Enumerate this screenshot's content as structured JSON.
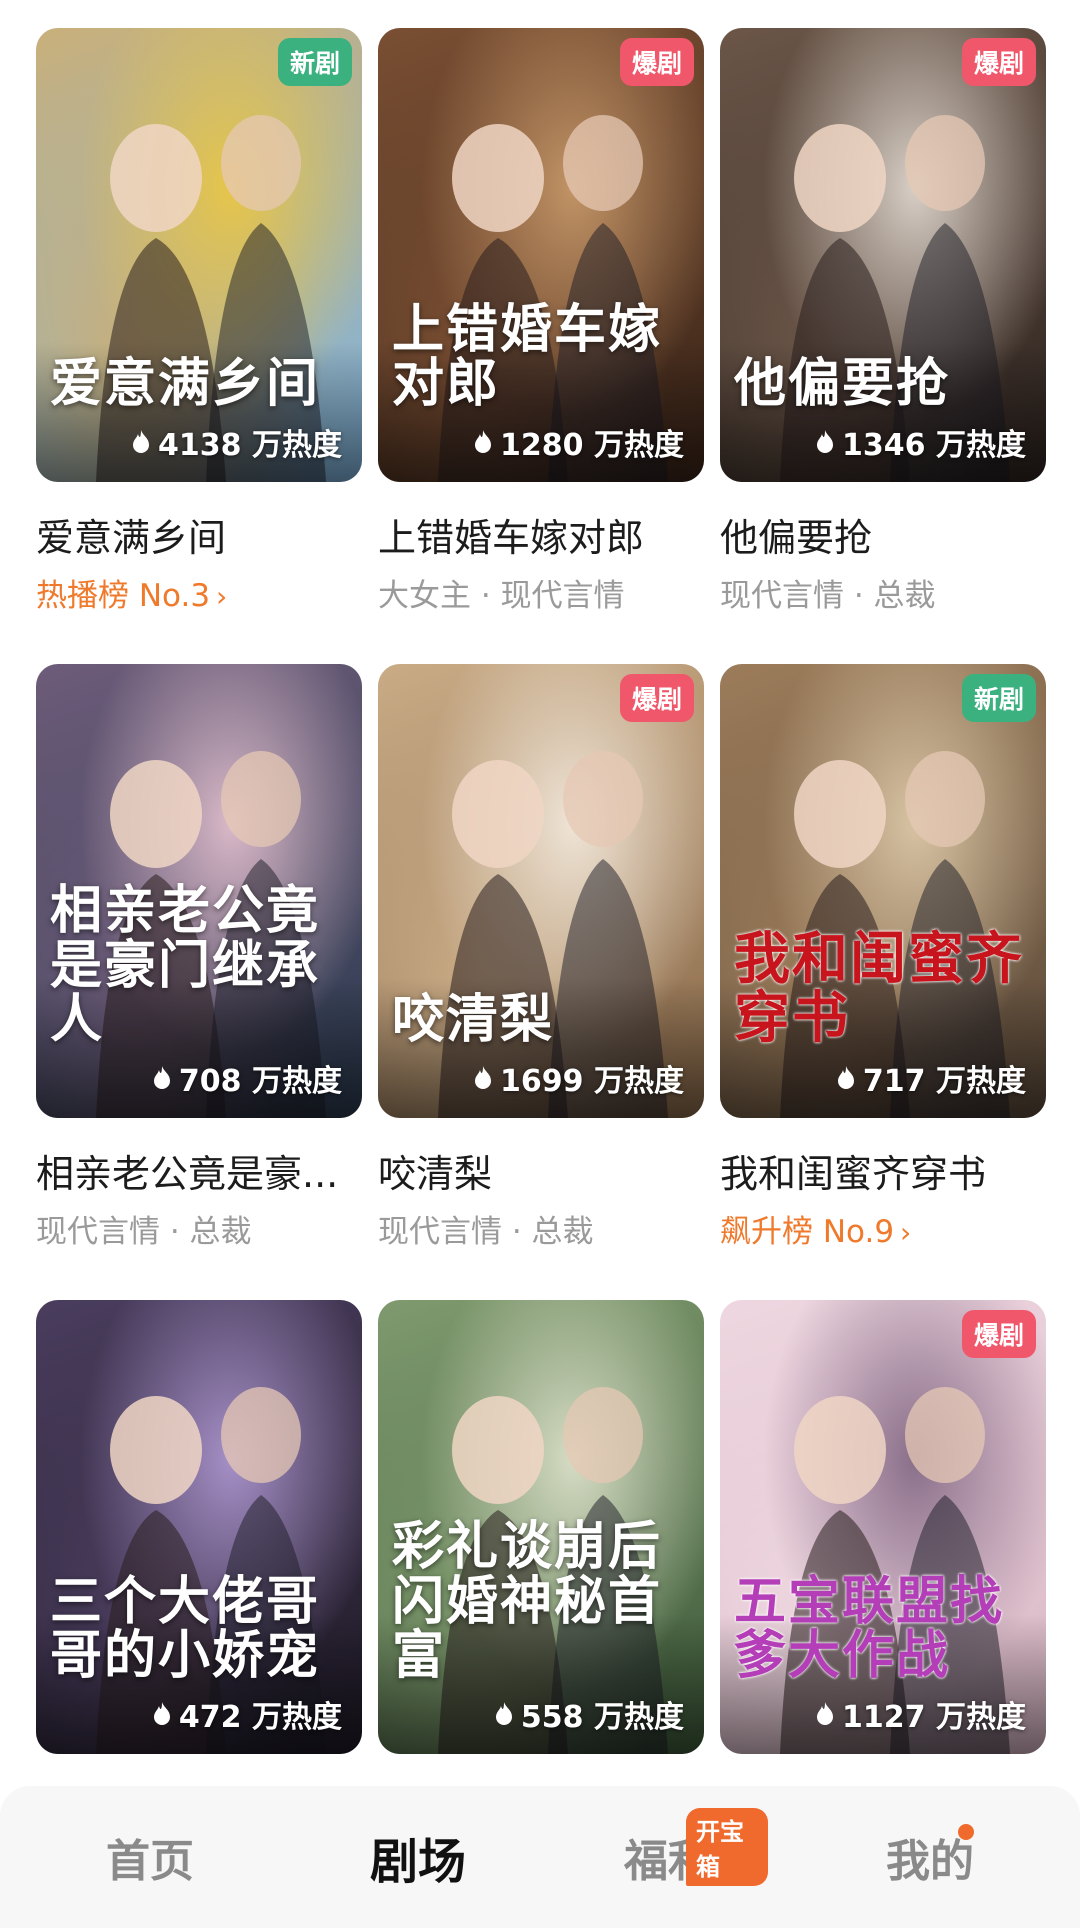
{
  "dramas": [
    {
      "badge": "新剧",
      "badge_type": "new",
      "title_art": "爱意满乡间",
      "heat": "4138 万热度",
      "name": "爱意满乡间",
      "sub": "热播榜 No.3",
      "sub_type": "rank",
      "palette": [
        "#7fb4de",
        "#c9b07a",
        "#e6c54a"
      ]
    },
    {
      "badge": "爆剧",
      "badge_type": "hot",
      "title_art": "上错婚车嫁对郎",
      "heat": "1280 万热度",
      "name": "上错婚车嫁对郎",
      "sub": "大女主 · 现代言情",
      "sub_type": "tags",
      "palette": [
        "#3a2418",
        "#7a4f33",
        "#c29466"
      ]
    },
    {
      "badge": "爆剧",
      "badge_type": "hot",
      "title_art": "他偏要抢",
      "heat": "1346 万热度",
      "name": "他偏要抢",
      "sub": "现代言情 · 总裁",
      "sub_type": "tags",
      "palette": [
        "#2e2420",
        "#6b5648",
        "#d8cfc6"
      ]
    },
    {
      "badge": "",
      "badge_type": "",
      "title_art": "相亲老公竟是豪门继承人",
      "heat": "708 万热度",
      "name": "相亲老公竟是豪...",
      "sub": "现代言情 · 总裁",
      "sub_type": "tags",
      "palette": [
        "#2b3a4f",
        "#6d5c7a",
        "#d9b9c8"
      ]
    },
    {
      "badge": "爆剧",
      "badge_type": "hot",
      "title_art": "咬清梨",
      "heat": "1699 万热度",
      "name": "咬清梨",
      "sub": "现代言情 · 总裁",
      "sub_type": "tags",
      "palette": [
        "#8a6a4a",
        "#c9ab86",
        "#efe4d6"
      ]
    },
    {
      "badge": "新剧",
      "badge_type": "new",
      "title_art": "我和闺蜜齐穿书",
      "heat": "717 万热度",
      "name": "我和闺蜜齐穿书",
      "sub": "飙升榜 No.9",
      "sub_type": "rank",
      "palette": [
        "#5b4a3a",
        "#9c7c5a",
        "#d7c3a3"
      ]
    },
    {
      "badge": "",
      "badge_type": "",
      "title_art": "三个大佬哥哥的小娇宠",
      "heat": "472 万热度",
      "name": "",
      "sub": "",
      "sub_type": "tags",
      "palette": [
        "#1f1a26",
        "#4a3d5e",
        "#a690c7"
      ]
    },
    {
      "badge": "",
      "badge_type": "",
      "title_art": "彩礼谈崩后闪婚神秘首富",
      "heat": "558 万热度",
      "name": "",
      "sub": "",
      "sub_type": "tags",
      "palette": [
        "#3e5a3a",
        "#7f9a6e",
        "#d6dcc4"
      ]
    },
    {
      "badge": "爆剧",
      "badge_type": "hot",
      "title_art": "五宝联盟找爹大作战",
      "heat": "1127 万热度",
      "name": "",
      "sub": "",
      "sub_type": "tags",
      "palette": [
        "#d9b7c5",
        "#eed7e0",
        "#8a6f8a"
      ]
    }
  ],
  "tabbar": {
    "tabs": [
      {
        "label": "首页",
        "active": false
      },
      {
        "label": "剧场",
        "active": true
      },
      {
        "label": "福利",
        "active": false,
        "badge": "开宝箱"
      },
      {
        "label": "我的",
        "active": false,
        "dot": true
      }
    ]
  },
  "colors": {
    "accent_orange": "#ef7a2c",
    "badge_new": "#3bb180",
    "badge_hot": "#f0576a"
  }
}
